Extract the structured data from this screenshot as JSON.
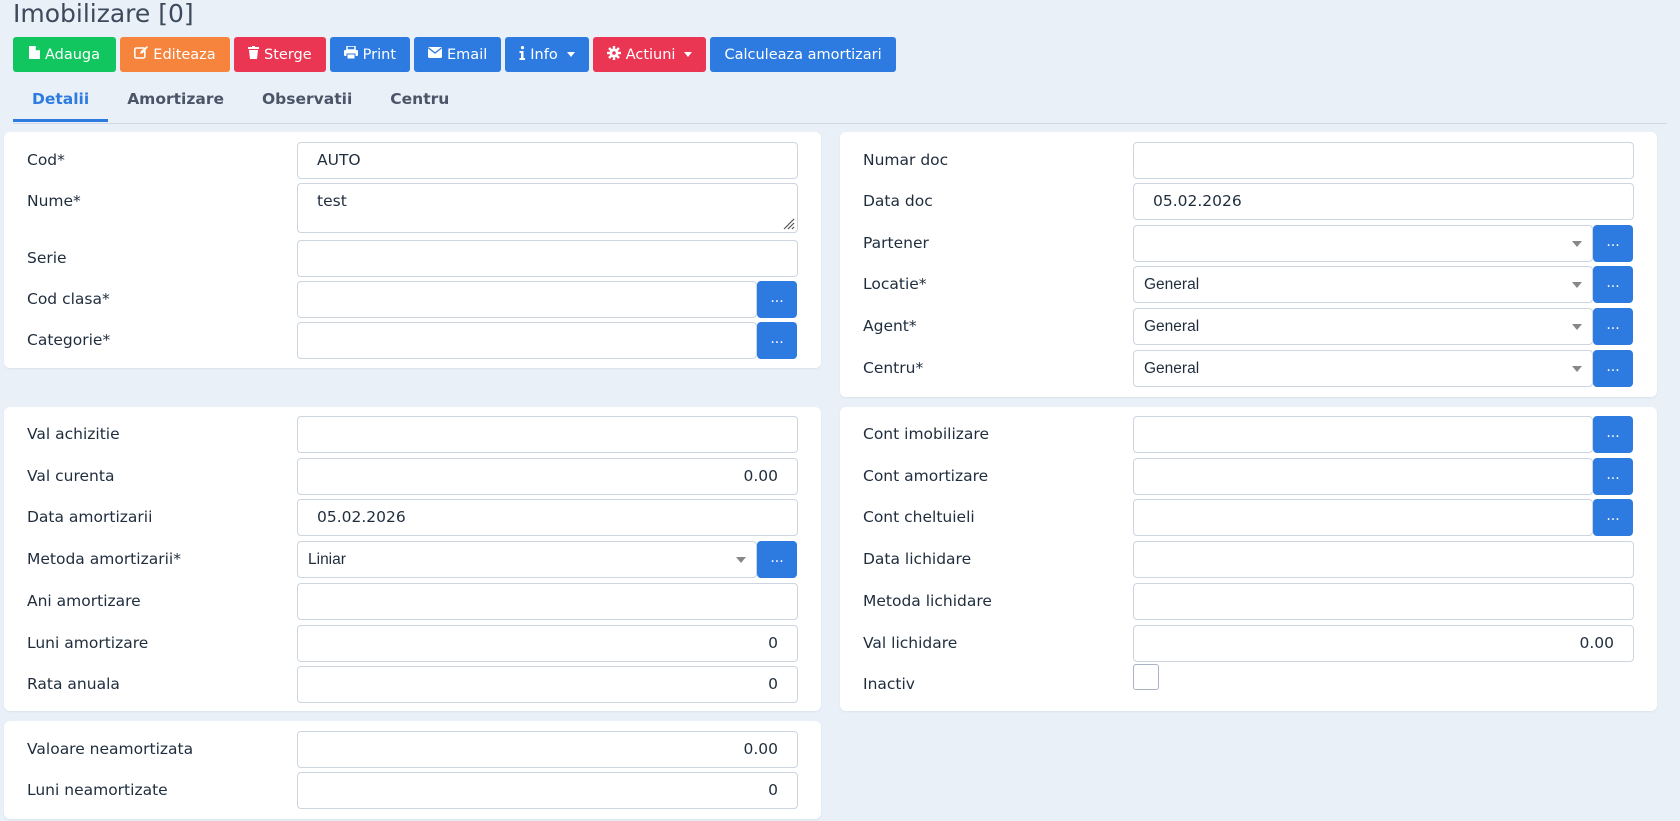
{
  "page": {
    "title": "Imobilizare [0]"
  },
  "toolbar": {
    "add": "Adauga",
    "edit": "Editeaza",
    "delete": "Sterge",
    "print": "Print",
    "email": "Email",
    "info": "Info",
    "actions": "Actiuni",
    "calculate": "Calculeaza amortizari"
  },
  "tabs": [
    "Detalii",
    "Amortizare",
    "Observatii",
    "Centru"
  ],
  "dots": "...",
  "card1": {
    "cod": {
      "label": "Cod*",
      "value": "AUTO"
    },
    "nume": {
      "label": "Nume*",
      "value": "test"
    },
    "serie": {
      "label": "Serie",
      "value": ""
    },
    "cod_clasa": {
      "label": "Cod clasa*",
      "value": ""
    },
    "categorie": {
      "label": "Categorie*",
      "value": ""
    }
  },
  "card2": {
    "numar_doc": {
      "label": "Numar doc",
      "value": ""
    },
    "data_doc": {
      "label": "Data doc",
      "value": "05.02.2026"
    },
    "partener": {
      "label": "Partener",
      "value": ""
    },
    "locatie": {
      "label": "Locatie*",
      "value": "General"
    },
    "agent": {
      "label": "Agent*",
      "value": "General"
    },
    "centru": {
      "label": "Centru*",
      "value": "General"
    }
  },
  "card3": {
    "val_achizitie": {
      "label": "Val achizitie",
      "value": ""
    },
    "val_curenta": {
      "label": "Val curenta",
      "value": "0.00"
    },
    "data_amortizarii": {
      "label": "Data amortizarii",
      "value": "05.02.2026"
    },
    "metoda_amortizarii": {
      "label": "Metoda amortizarii*",
      "value": "Liniar"
    },
    "ani_amortizare": {
      "label": "Ani amortizare",
      "value": ""
    },
    "luni_amortizare": {
      "label": "Luni amortizare",
      "value": "0"
    },
    "rata_anuala": {
      "label": "Rata anuala",
      "value": "0"
    }
  },
  "card4": {
    "cont_imobilizare": {
      "label": "Cont imobilizare",
      "value": ""
    },
    "cont_amortizare": {
      "label": "Cont amortizare",
      "value": ""
    },
    "cont_cheltuieli": {
      "label": "Cont cheltuieli",
      "value": ""
    },
    "data_lichidare": {
      "label": "Data lichidare",
      "value": ""
    },
    "metoda_lichidare": {
      "label": "Metoda lichidare",
      "value": ""
    },
    "val_lichidare": {
      "label": "Val lichidare",
      "value": "0.00"
    },
    "inactiv": {
      "label": "Inactiv",
      "checked": false
    }
  },
  "card5": {
    "valoare_neamortizata": {
      "label": "Valoare neamortizata",
      "value": "0.00"
    },
    "luni_neamortizate": {
      "label": "Luni neamortizate",
      "value": "0"
    }
  }
}
